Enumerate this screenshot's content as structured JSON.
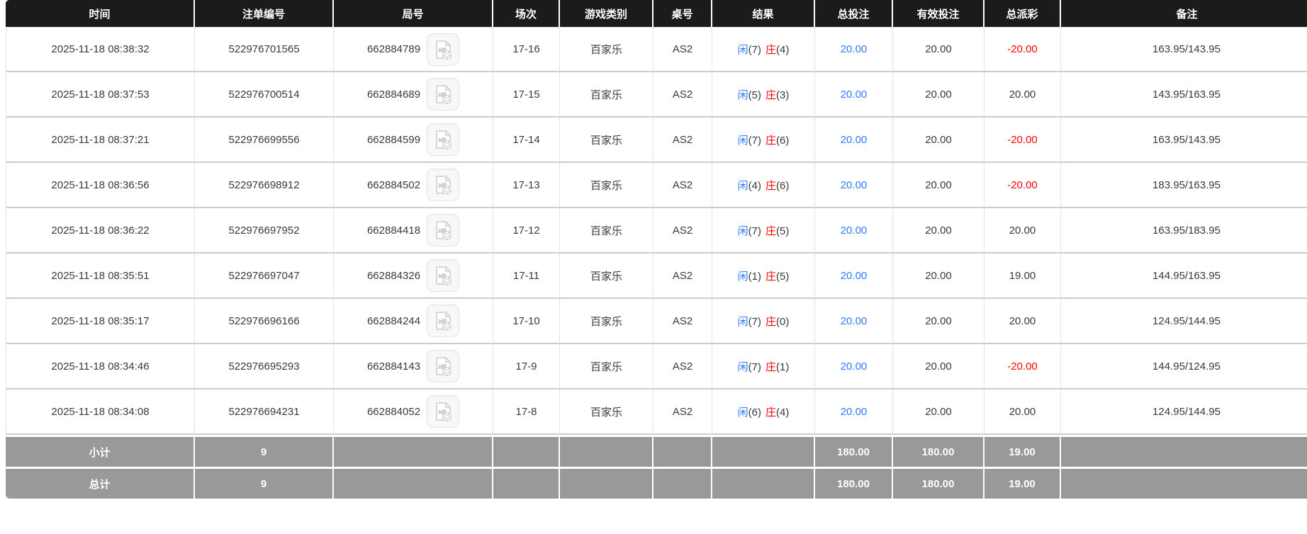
{
  "colors": {
    "header_bg": "#1b1b1b",
    "header_text": "#ffffff",
    "footer_bg": "#999999",
    "accent_blue": "#2f7bff",
    "accent_red": "#ff0000",
    "body_text": "#3a3a3a",
    "grid_line": "#cccccc"
  },
  "table": {
    "columns": [
      "时间",
      "注单编号",
      "局号",
      "场次",
      "游戏类别",
      "桌号",
      "结果",
      "总投注",
      "有效投注",
      "总派彩",
      "备注"
    ],
    "video_icon_name": "video-file-icon",
    "rows": [
      {
        "time": "2025-11-18 08:38:32",
        "order_no": "522976701565",
        "round_no": "662884789",
        "session": "17-16",
        "game_type": "百家乐",
        "table_no": "AS2",
        "result": {
          "p_label": "闲",
          "p_score": "(7)",
          "b_label": "庄",
          "b_score": "(4)"
        },
        "total_bet": "20.00",
        "valid_bet": "20.00",
        "total_payout": "-20.00",
        "remark": "163.95/143.95"
      },
      {
        "time": "2025-11-18 08:37:53",
        "order_no": "522976700514",
        "round_no": "662884689",
        "session": "17-15",
        "game_type": "百家乐",
        "table_no": "AS2",
        "result": {
          "p_label": "闲",
          "p_score": "(5)",
          "b_label": "庄",
          "b_score": "(3)"
        },
        "total_bet": "20.00",
        "valid_bet": "20.00",
        "total_payout": "20.00",
        "remark": "143.95/163.95"
      },
      {
        "time": "2025-11-18 08:37:21",
        "order_no": "522976699556",
        "round_no": "662884599",
        "session": "17-14",
        "game_type": "百家乐",
        "table_no": "AS2",
        "result": {
          "p_label": "闲",
          "p_score": "(7)",
          "b_label": "庄",
          "b_score": "(6)"
        },
        "total_bet": "20.00",
        "valid_bet": "20.00",
        "total_payout": "-20.00",
        "remark": "163.95/143.95"
      },
      {
        "time": "2025-11-18 08:36:56",
        "order_no": "522976698912",
        "round_no": "662884502",
        "session": "17-13",
        "game_type": "百家乐",
        "table_no": "AS2",
        "result": {
          "p_label": "闲",
          "p_score": "(4)",
          "b_label": "庄",
          "b_score": "(6)"
        },
        "total_bet": "20.00",
        "valid_bet": "20.00",
        "total_payout": "-20.00",
        "remark": "183.95/163.95"
      },
      {
        "time": "2025-11-18 08:36:22",
        "order_no": "522976697952",
        "round_no": "662884418",
        "session": "17-12",
        "game_type": "百家乐",
        "table_no": "AS2",
        "result": {
          "p_label": "闲",
          "p_score": "(7)",
          "b_label": "庄",
          "b_score": "(5)"
        },
        "total_bet": "20.00",
        "valid_bet": "20.00",
        "total_payout": "20.00",
        "remark": "163.95/183.95"
      },
      {
        "time": "2025-11-18 08:35:51",
        "order_no": "522976697047",
        "round_no": "662884326",
        "session": "17-11",
        "game_type": "百家乐",
        "table_no": "AS2",
        "result": {
          "p_label": "闲",
          "p_score": "(1)",
          "b_label": "庄",
          "b_score": "(5)"
        },
        "total_bet": "20.00",
        "valid_bet": "20.00",
        "total_payout": "19.00",
        "remark": "144.95/163.95"
      },
      {
        "time": "2025-11-18 08:35:17",
        "order_no": "522976696166",
        "round_no": "662884244",
        "session": "17-10",
        "game_type": "百家乐",
        "table_no": "AS2",
        "result": {
          "p_label": "闲",
          "p_score": "(7)",
          "b_label": "庄",
          "b_score": "(0)"
        },
        "total_bet": "20.00",
        "valid_bet": "20.00",
        "total_payout": "20.00",
        "remark": "124.95/144.95"
      },
      {
        "time": "2025-11-18 08:34:46",
        "order_no": "522976695293",
        "round_no": "662884143",
        "session": "17-9",
        "game_type": "百家乐",
        "table_no": "AS2",
        "result": {
          "p_label": "闲",
          "p_score": "(7)",
          "b_label": "庄",
          "b_score": "(1)"
        },
        "total_bet": "20.00",
        "valid_bet": "20.00",
        "total_payout": "-20.00",
        "remark": "144.95/124.95"
      },
      {
        "time": "2025-11-18 08:34:08",
        "order_no": "522976694231",
        "round_no": "662884052",
        "session": "17-8",
        "game_type": "百家乐",
        "table_no": "AS2",
        "result": {
          "p_label": "闲",
          "p_score": "(6)",
          "b_label": "庄",
          "b_score": "(4)"
        },
        "total_bet": "20.00",
        "valid_bet": "20.00",
        "total_payout": "20.00",
        "remark": "124.95/144.95"
      }
    ],
    "footer": [
      {
        "label": "小计",
        "count": "9",
        "total_bet": "180.00",
        "valid_bet": "180.00",
        "total_payout": "19.00"
      },
      {
        "label": "总计",
        "count": "9",
        "total_bet": "180.00",
        "valid_bet": "180.00",
        "total_payout": "19.00"
      }
    ]
  }
}
